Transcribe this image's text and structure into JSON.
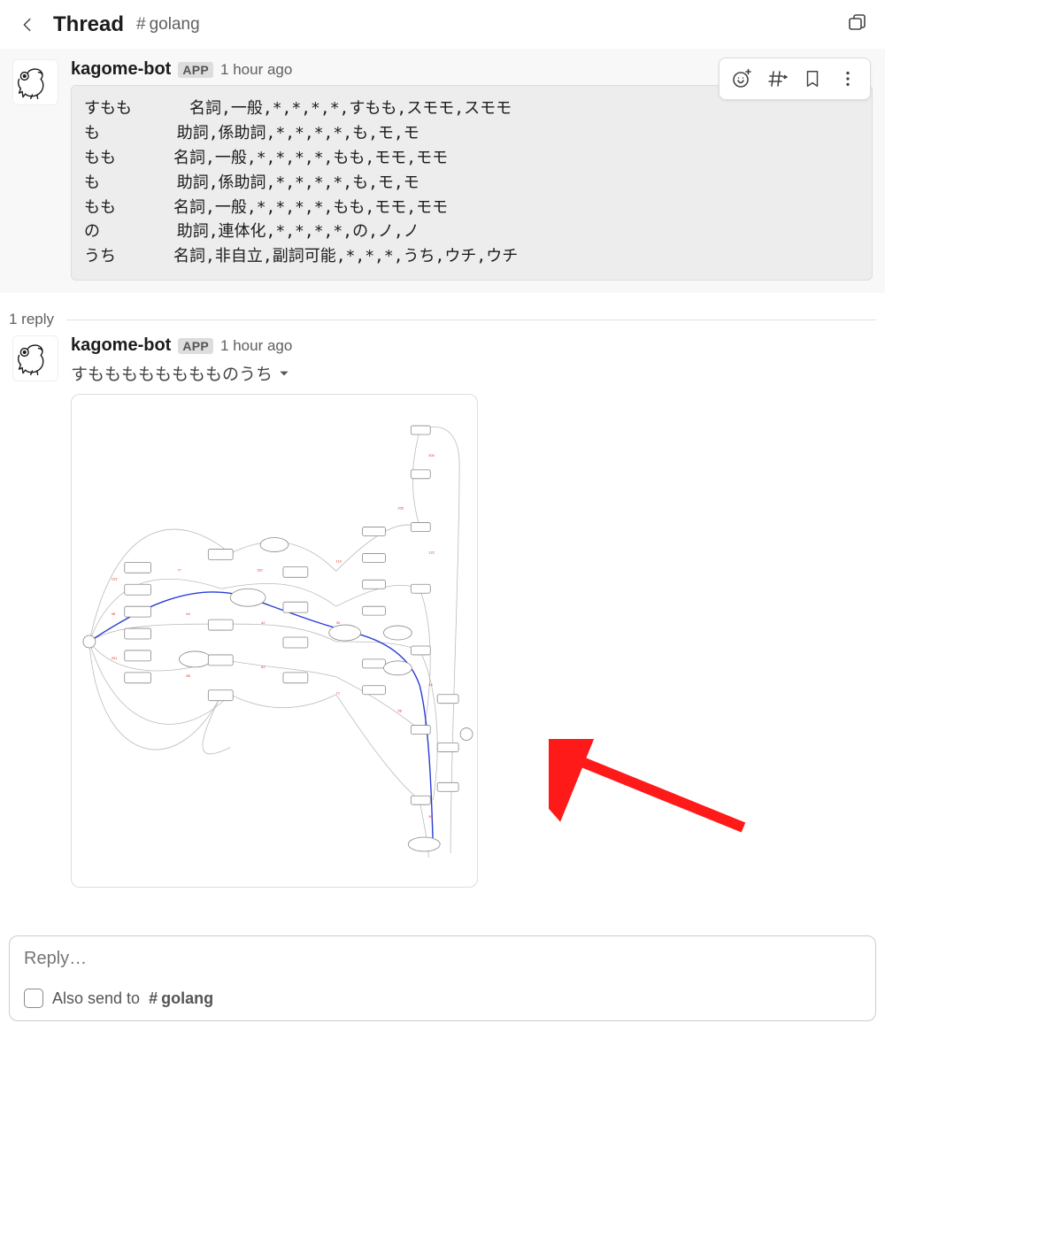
{
  "header": {
    "title": "Thread",
    "channel": "golang"
  },
  "root_message": {
    "author": "kagome-bot",
    "badge": "APP",
    "timestamp": "1 hour ago",
    "code": "すもも      名詞,一般,*,*,*,*,すもも,スモモ,スモモ\nも        助詞,係助詞,*,*,*,*,も,モ,モ\nもも      名詞,一般,*,*,*,*,もも,モモ,モモ\nも        助詞,係助詞,*,*,*,*,も,モ,モ\nもも      名詞,一般,*,*,*,*,もも,モモ,モモ\nの        助詞,連体化,*,*,*,*,の,ノ,ノ\nうち      名詞,非自立,副詞可能,*,*,*,うち,ウチ,ウチ"
  },
  "reply_divider": {
    "text": "1 reply"
  },
  "reply_message": {
    "author": "kagome-bot",
    "badge": "APP",
    "timestamp": "1 hour ago",
    "text": "すもももももももものうち"
  },
  "composer": {
    "placeholder": "Reply…",
    "also_send_label": "Also send to",
    "also_send_channel": "golang"
  },
  "icons": {
    "back": "back-icon",
    "open_window": "open-window-icon",
    "react": "add-reaction-icon",
    "share_channel": "share-channel-icon",
    "bookmark": "bookmark-icon",
    "more": "more-icon",
    "chevron_down": "chevron-down-icon"
  }
}
